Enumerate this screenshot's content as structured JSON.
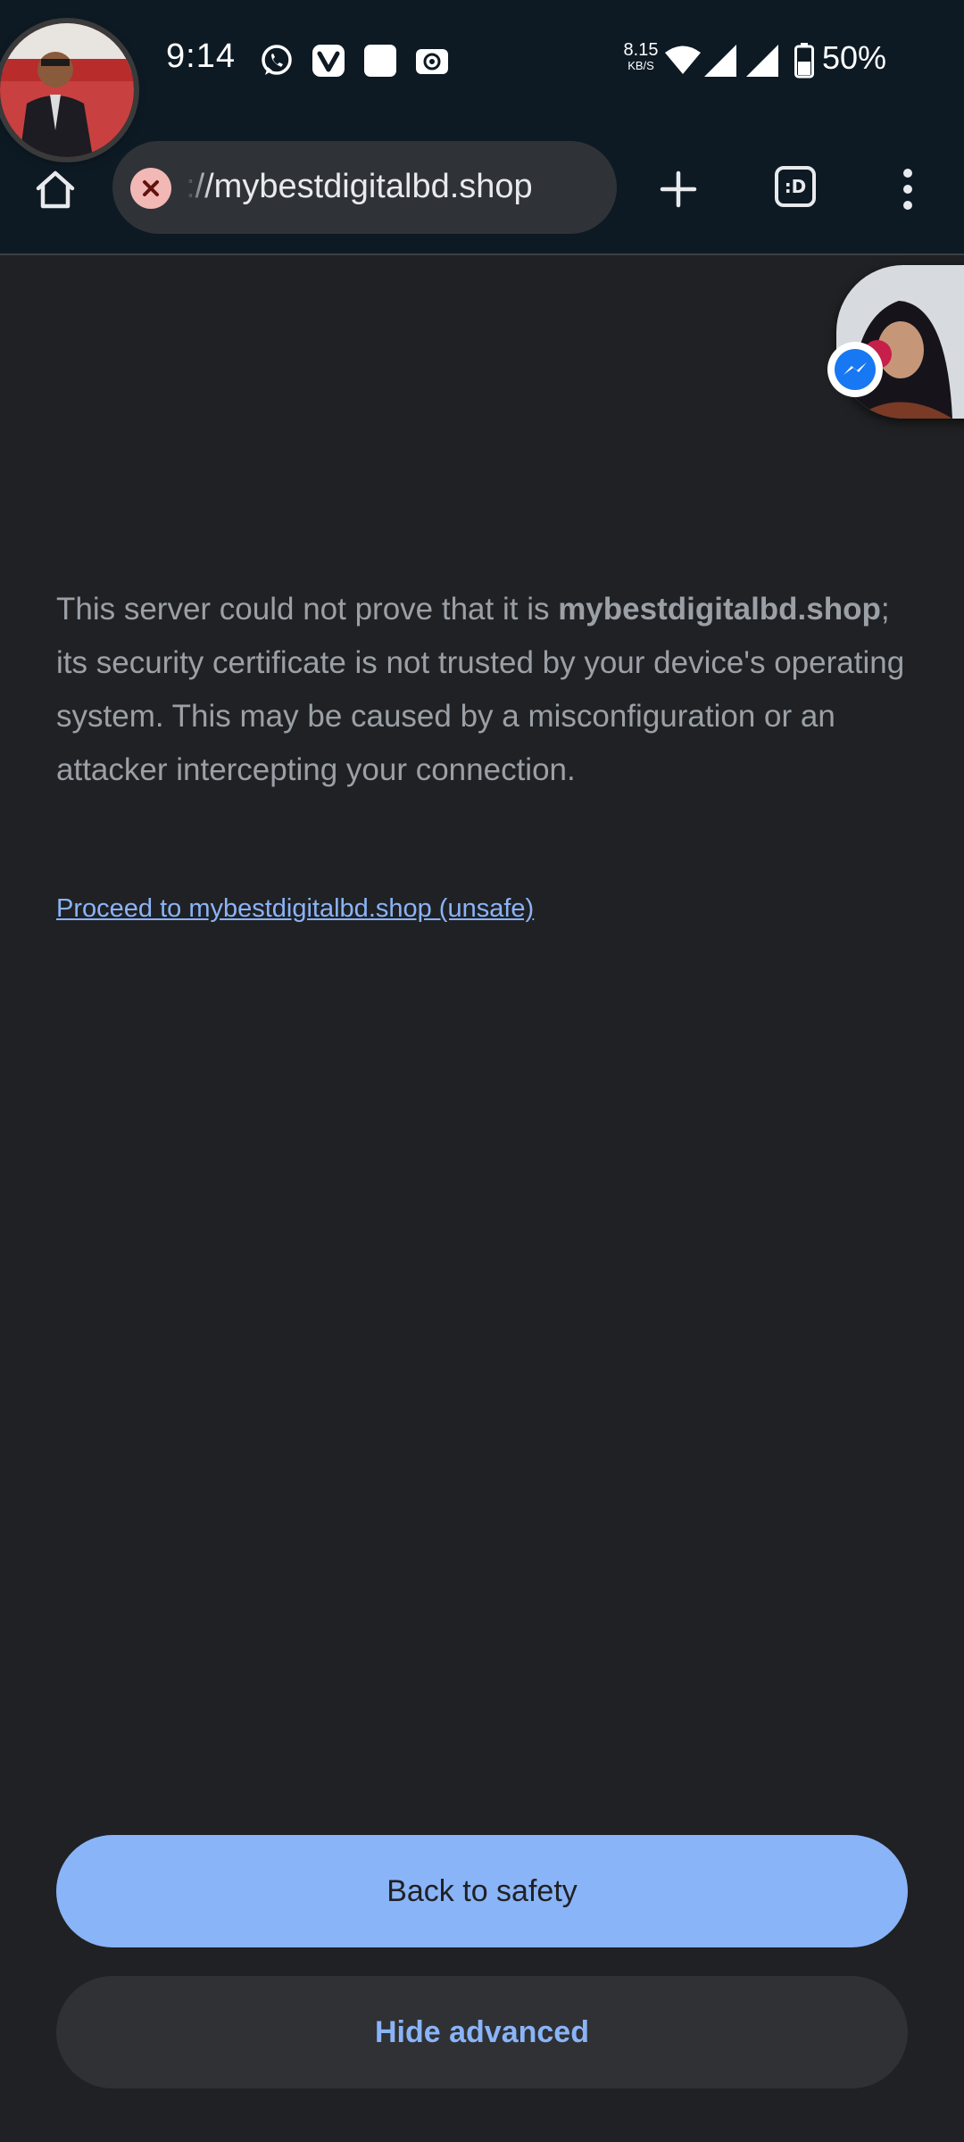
{
  "status_bar": {
    "time": "9:14",
    "net_speed_value": "8.15",
    "net_speed_unit": "KB/S",
    "battery_percent": "50%",
    "notification_icons": [
      "whatsapp-icon",
      "vivaldi-icon",
      "blank-square-icon",
      "radio-icon"
    ]
  },
  "browser": {
    "url": "://mybestdigitalbd.shop",
    "tab_switcher_label": ":D"
  },
  "interstitial": {
    "text_before": "This server could not prove that it is ",
    "domain": "mybestdigitalbd.shop",
    "text_after": "; its security certificate is not trusted by your device's operating system. This may be caused by a misconfiguration or an attacker intercepting your connection.",
    "proceed_link": "Proceed to mybestdigitalbd.shop (unsafe)",
    "back_button": "Back to safety",
    "hide_button": "Hide advanced"
  },
  "colors": {
    "background": "#202124",
    "accent": "#8ab4f8",
    "not_secure_badge": "#f2b8b5"
  }
}
